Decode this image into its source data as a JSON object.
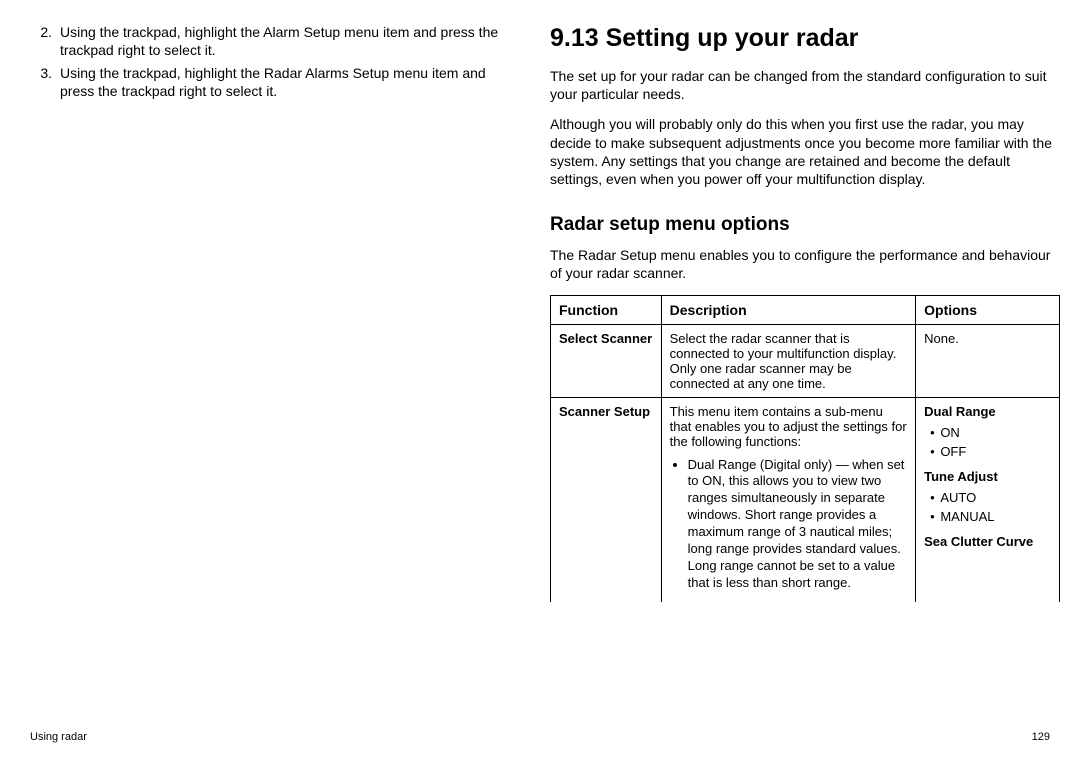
{
  "left": {
    "items": [
      {
        "num": "2.",
        "text": "Using the trackpad, highlight the Alarm Setup menu item and press the trackpad right to select it."
      },
      {
        "num": "3.",
        "text": "Using the trackpad, highlight the Radar Alarms Setup menu item and press the trackpad right to select it."
      }
    ]
  },
  "right": {
    "title": "9.13 Setting up your radar",
    "para1": "The set up for your radar can be changed from the standard configuration to suit your particular needs.",
    "para2": "Although you will probably only do this when you first use the radar, you may decide to make subsequent adjustments once you become more familiar with the system.  Any settings that you change are retained and become the default settings, even when you power off your multifunction display.",
    "subhead": "Radar setup menu options",
    "para3": "The Radar Setup menu enables you to configure the performance and behaviour of your radar scanner.",
    "table": {
      "headers": {
        "h1": "Function",
        "h2": "Description",
        "h3": "Options"
      },
      "rows": [
        {
          "func": "Select Scanner",
          "desc": "Select the radar scanner that is connected to your multifunction display.  Only one radar scanner may be connected at any one time.",
          "opts_plain": "None."
        },
        {
          "func": "Scanner Setup",
          "desc_intro": "This menu item contains a sub-menu that enables you to adjust the settings for the following functions:",
          "desc_bullet": "Dual Range (Digital only) — when set to ON, this allows you to view two ranges simultaneously in separate windows.  Short range provides a maximum range of 3 nautical miles; long range provides standard values.  Long range cannot be set to a value that is less than short range.",
          "opts": [
            {
              "head": "Dual Range",
              "items": [
                "ON",
                "OFF"
              ]
            },
            {
              "head": "Tune Adjust",
              "items": [
                "AUTO",
                "MANUAL"
              ]
            },
            {
              "head": "Sea Clutter Curve"
            }
          ]
        }
      ]
    }
  },
  "footer": {
    "left": "Using radar",
    "right": "129"
  }
}
